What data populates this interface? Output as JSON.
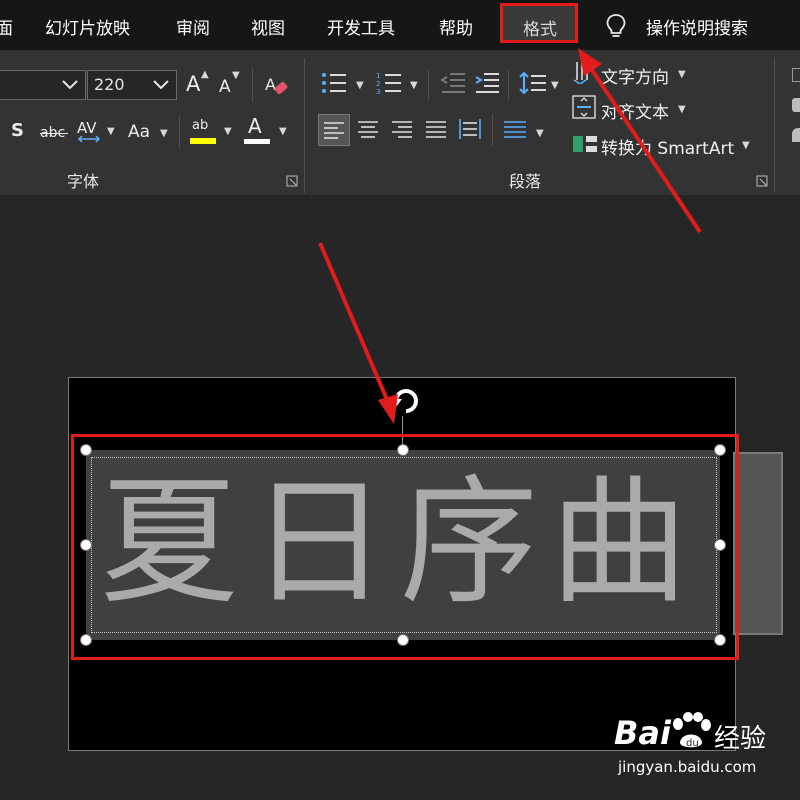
{
  "menu": {
    "partial_left": "面",
    "items": [
      "幻灯片放映",
      "审阅",
      "视图",
      "开发工具",
      "帮助",
      "格式"
    ],
    "tell_me": "操作说明搜索"
  },
  "font_group": {
    "label": "字体",
    "font_name": "",
    "font_size": "220",
    "grow_glyph": "A",
    "shrink_glyph": "A",
    "shadow_glyph": "S",
    "strike_glyph": "abc",
    "spacing_glyph": "AV",
    "case_glyph": "Aa",
    "highlight_glyph": "ab",
    "color_glyph": "A"
  },
  "paragraph_group": {
    "label": "段落",
    "text_direction": "文字方向",
    "align_text": "对齐文本",
    "convert_smartart": "转换为 SmartArt"
  },
  "slide": {
    "title_text": "夏日序曲"
  },
  "watermark": {
    "brand": "Bai",
    "brand_suffix": "经验",
    "url": "jingyan.baidu.com"
  },
  "colors": {
    "accent_red": "#e21b1b",
    "highlight_yellow": "#ffff00",
    "text_grey": "#aaaaaa",
    "textbox_fill": "#404040"
  }
}
